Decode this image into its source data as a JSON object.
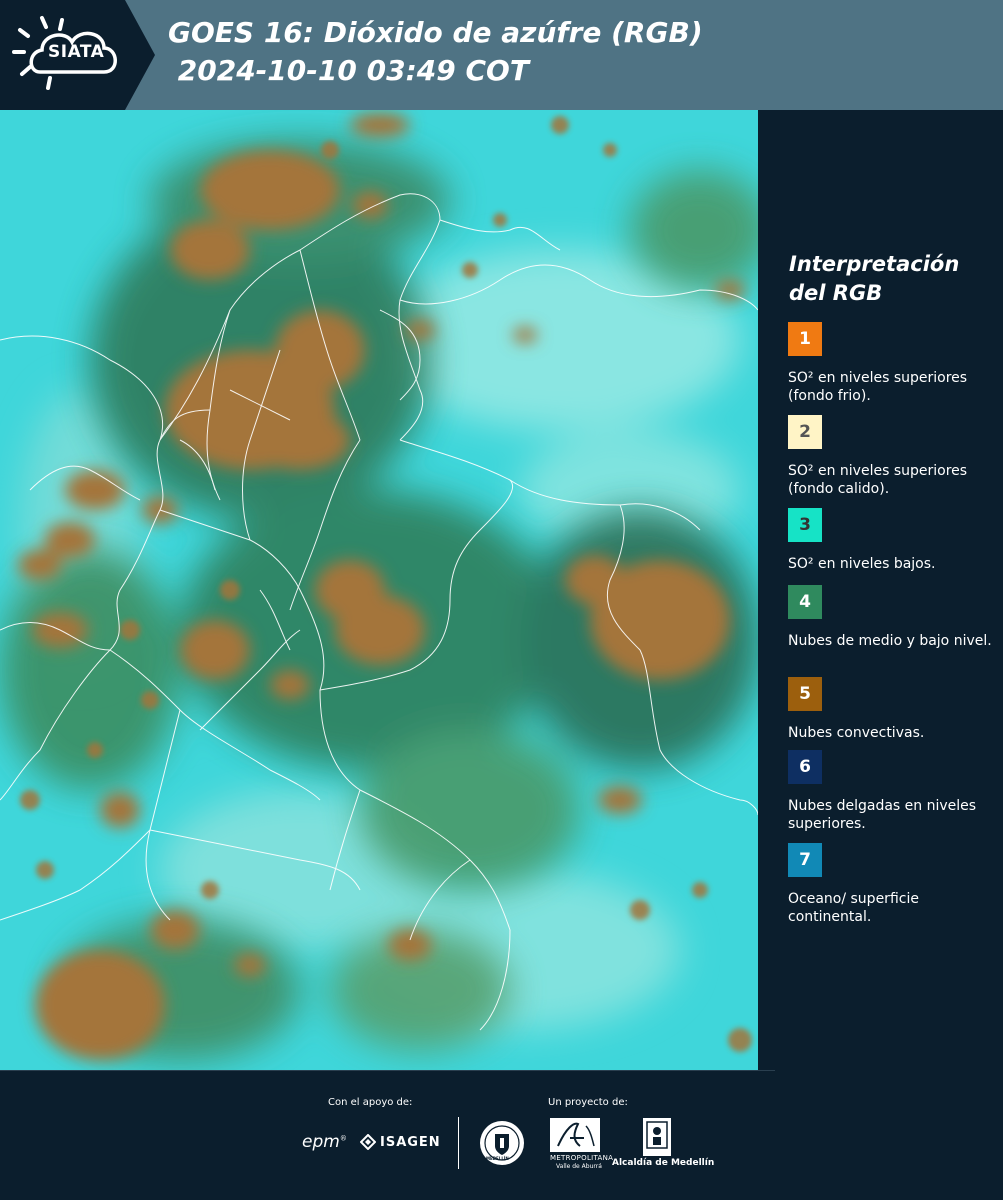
{
  "header": {
    "logo_text": "SIATA",
    "title_line1": "GOES 16: Dióxido de azúfre (RGB)",
    "title_line2": " 2024-10-10 03:49 COT"
  },
  "legend": {
    "title_line1": "Interpretación",
    "title_line2": "del RGB",
    "items": [
      {
        "number": "1",
        "color": "#f07a12",
        "num_color": "#ffffff",
        "label": "SO² en niveles superiores (fondo frio)."
      },
      {
        "number": "2",
        "color": "#fff4c6",
        "num_color": "#555555",
        "label": "SO² en niveles superiores (fondo calido)."
      },
      {
        "number": "3",
        "color": "#16e3c6",
        "num_color": "#333333",
        "label": "SO² en niveles bajos."
      },
      {
        "number": "4",
        "color": "#2f8a5e",
        "num_color": "#ffffff",
        "label": "Nubes de medio y bajo nivel."
      },
      {
        "number": "5",
        "color": "#9c5f0d",
        "num_color": "#ffffff",
        "label": "Nubes convectivas."
      },
      {
        "number": "6",
        "color": "#0e2f62",
        "num_color": "#ffffff",
        "label": "Nubes delgadas en niveles superiores."
      },
      {
        "number": "7",
        "color": "#1189b6",
        "num_color": "#ffffff",
        "label": "Oceano/ superficie continental."
      }
    ]
  },
  "footer": {
    "support_label": "Con el apoyo de:",
    "project_label": "Un proyecto de:",
    "epm": "epm",
    "isagen": "ISAGEN",
    "metropolitana": "METROPOLITANA",
    "valle": "Valle de Aburrá",
    "alcaldia": "Alcaldía de Medellín",
    "medellin_seal": "MEDELLÍN"
  },
  "colors": {
    "background": "#0b1e2d",
    "header_band": "#4f7384",
    "ocean": "#3ed4d8",
    "convective": "#a4743a",
    "mid_cloud": "#2f8a5e"
  }
}
